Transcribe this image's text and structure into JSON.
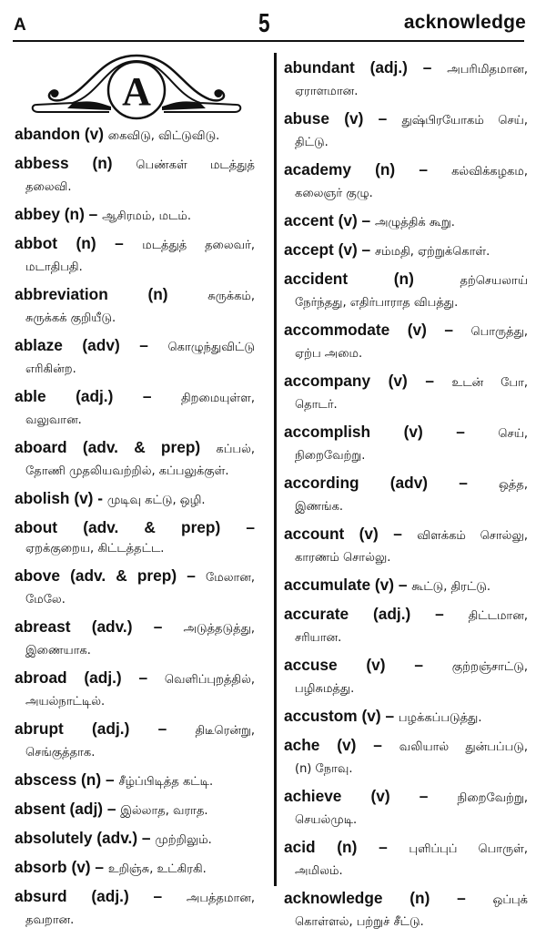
{
  "header": {
    "section_letter": "A",
    "page_number": "5",
    "guide_word": "acknowledge"
  },
  "emblem": {
    "letter": "A",
    "icon": "ornamental-letter-emblem"
  },
  "left_column": [
    {
      "word": "abandon",
      "pos": "(v)",
      "sep": "",
      "meaning_first": "கைவிடு, விட்டுவிடு.",
      "meaning_rest": ""
    },
    {
      "word": "abbess",
      "pos": "(n)",
      "sep": "",
      "meaning_first": "பெண்கள் மடத்துத்",
      "meaning_rest": "தலைவி."
    },
    {
      "word": "abbey",
      "pos": "(n)",
      "sep": "–",
      "meaning_first": "ஆசிரமம், மடம்.",
      "meaning_rest": ""
    },
    {
      "word": "abbot",
      "pos": "(n)",
      "sep": "–",
      "meaning_first": "மடத்துத் தலைவர்,",
      "meaning_rest": "மடாதிபதி."
    },
    {
      "word": "abbreviation",
      "pos": "(n)",
      "sep": "",
      "meaning_first": "சுருக்கம்,",
      "meaning_rest": "சுருக்கக் குறியீடு."
    },
    {
      "word": "ablaze",
      "pos": "(adv)",
      "sep": "–",
      "meaning_first": "கொழுந்துவிட்டு",
      "meaning_rest": "எரிகின்ற."
    },
    {
      "word": "able",
      "pos": "(adj.)",
      "sep": "–",
      "meaning_first": "திறமையுள்ள,",
      "meaning_rest": "வலுவான."
    },
    {
      "word": "aboard",
      "pos": "(adv. & prep)",
      "sep": "",
      "meaning_first": "கப்பல்,",
      "meaning_rest": "தோணி முதலியவற்றில், கப்பலுக்குள்."
    },
    {
      "word": "abolish",
      "pos": "(v)",
      "sep": "-",
      "meaning_first": "முடிவு கட்டு, ஒழி.",
      "meaning_rest": ""
    },
    {
      "word": "about",
      "pos": "(adv. & prep)",
      "sep": "–",
      "meaning_first": "",
      "meaning_rest": "ஏறக்குறைய, கிட்டத்தட்ட."
    },
    {
      "word": "above",
      "pos": "(adv. & prep)",
      "sep": "–",
      "meaning_first": "மேலான,",
      "meaning_rest": "மேலே."
    },
    {
      "word": "abreast",
      "pos": "(adv.)",
      "sep": "–",
      "meaning_first": "அடுத்தடுத்து,",
      "meaning_rest": "இணையாக."
    },
    {
      "word": "abroad",
      "pos": "(adj.)",
      "sep": "–",
      "meaning_first": "வெளிப்புறத்தில்,",
      "meaning_rest": "அயல்நாட்டில்."
    },
    {
      "word": "abrupt",
      "pos": "(adj.)",
      "sep": "–",
      "meaning_first": "திடீரென்று,",
      "meaning_rest": "செங்குத்தாக."
    },
    {
      "word": "abscess",
      "pos": "(n)",
      "sep": "–",
      "meaning_first": "சீழ்ப்பிடித்த கட்டி.",
      "meaning_rest": ""
    },
    {
      "word": "absent",
      "pos": "(adj)",
      "sep": "–",
      "meaning_first": "இல்லாத, வராத.",
      "meaning_rest": ""
    },
    {
      "word": "absolutely",
      "pos": "(adv.)",
      "sep": "–",
      "meaning_first": "முற்றிலும்.",
      "meaning_rest": ""
    },
    {
      "word": "absorb",
      "pos": "(v)",
      "sep": "–",
      "meaning_first": "உறிஞ்சு, உட்கிரகி.",
      "meaning_rest": ""
    },
    {
      "word": "absurd",
      "pos": "(adj.)",
      "sep": "–",
      "meaning_first": "அபத்தமான,",
      "meaning_rest": "தவறான."
    }
  ],
  "right_column": [
    {
      "word": "abundant",
      "pos": "(adj.)",
      "sep": "–",
      "meaning_first": "அபரிமிதமான,",
      "meaning_rest": "ஏராளமான."
    },
    {
      "word": "abuse",
      "pos": "(v)",
      "sep": "–",
      "meaning_first": "துஷ்பிரயோகம் செய்,",
      "meaning_rest": "திட்டு."
    },
    {
      "word": "academy",
      "pos": "(n)",
      "sep": "–",
      "meaning_first": "கல்விக்கழகம,",
      "meaning_rest": "கலைஞர் குழு."
    },
    {
      "word": "accent",
      "pos": "(v)",
      "sep": "–",
      "meaning_first": "அழுத்திக் கூறு.",
      "meaning_rest": ""
    },
    {
      "word": "accept",
      "pos": "(v)",
      "sep": "–",
      "meaning_first": "சம்மதி, ஏற்றுக்கொள்.",
      "meaning_rest": ""
    },
    {
      "word": "accident",
      "pos": "(n)",
      "sep": "",
      "meaning_first": "தற்செயலாய்",
      "meaning_rest": "நேர்ந்தது, எதிர்பாராத விபத்து."
    },
    {
      "word": "accommodate",
      "pos": "(v)",
      "sep": "–",
      "meaning_first": "பொருத்து,",
      "meaning_rest": "ஏற்ப அமை."
    },
    {
      "word": "accompany",
      "pos": "(v)",
      "sep": "–",
      "meaning_first": "உடன் போ,",
      "meaning_rest": "தொடர்."
    },
    {
      "word": "accomplish",
      "pos": "(v)",
      "sep": "–",
      "meaning_first": "செய்,",
      "meaning_rest": "நிறைவேற்று."
    },
    {
      "word": "according",
      "pos": "(adv)",
      "sep": "–",
      "meaning_first": "ஒத்த,",
      "meaning_rest": "இணங்க."
    },
    {
      "word": "account",
      "pos": "(v)",
      "sep": "–",
      "meaning_first": "விளக்கம் சொல்லு,",
      "meaning_rest": "காரணம் சொல்லு."
    },
    {
      "word": "accumulate",
      "pos": "(v)",
      "sep": "–",
      "meaning_first": "கூட்டு, திரட்டு.",
      "meaning_rest": ""
    },
    {
      "word": "accurate",
      "pos": "(adj.)",
      "sep": "–",
      "meaning_first": "திட்டமான,",
      "meaning_rest": "சரியான."
    },
    {
      "word": "accuse",
      "pos": "(v)",
      "sep": "–",
      "meaning_first": "குற்றஞ்சாட்டு,",
      "meaning_rest": "பழிசுமத்து."
    },
    {
      "word": "accustom",
      "pos": "(v)",
      "sep": "–",
      "meaning_first": "பழக்கப்படுத்து.",
      "meaning_rest": ""
    },
    {
      "word": "ache",
      "pos": "(v)",
      "sep": "–",
      "meaning_first": "வலியால் துன்பப்படு,",
      "meaning_rest": "(n) நோவு."
    },
    {
      "word": "achieve",
      "pos": "(v)",
      "sep": "–",
      "meaning_first": "நிறைவேற்று,",
      "meaning_rest": "செயல்முடி."
    },
    {
      "word": "acid",
      "pos": "(n)",
      "sep": "–",
      "meaning_first": "புளிப்புப் பொருள்,",
      "meaning_rest": "அமிலம்."
    },
    {
      "word": "acknowledge",
      "pos": "(n)",
      "sep": "–",
      "meaning_first": "ஒப்புக்",
      "meaning_rest": "கொள்ளல், பற்றுச் சீட்டு."
    }
  ]
}
